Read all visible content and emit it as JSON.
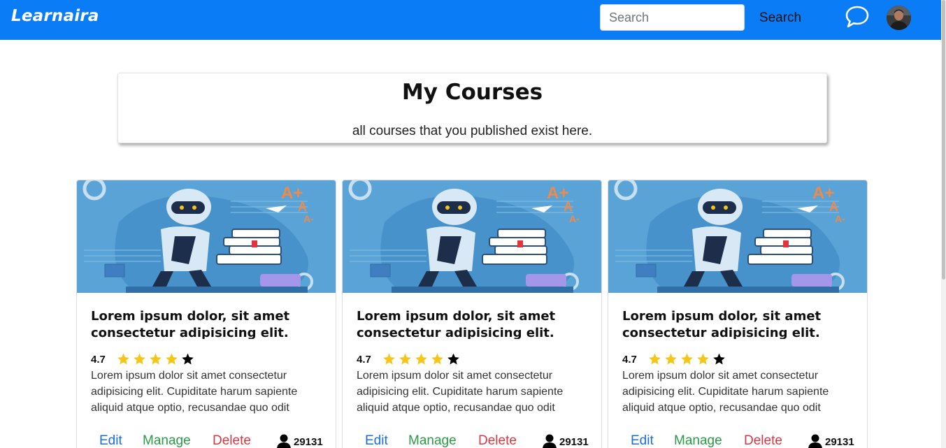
{
  "navbar": {
    "brand": "Learnaira",
    "search_placeholder": "Search",
    "search_button": "Search",
    "chat_icon": "chat-bubble-icon",
    "avatar": "user-avatar"
  },
  "header": {
    "title": "My Courses",
    "subtitle": "all courses that you published exist here."
  },
  "courses": [
    {
      "title": "Lorem ipsum dolor, sit amet consectetur adipisicing elit.",
      "rating": "4.7",
      "stars_filled": 4,
      "stars_total": 5,
      "description": "Lorem ipsum dolor sit amet consectetur adipisicing elit. Cupiditate harum sapiente aliquid atque optio, recusandae quo odit",
      "edit": "Edit",
      "manage": "Manage",
      "delete": "Delete",
      "students": "29131"
    },
    {
      "title": "Lorem ipsum dolor, sit amet consectetur adipisicing elit.",
      "rating": "4.7",
      "stars_filled": 4,
      "stars_total": 5,
      "description": "Lorem ipsum dolor sit amet consectetur adipisicing elit. Cupiditate harum sapiente aliquid atque optio, recusandae quo odit",
      "edit": "Edit",
      "manage": "Manage",
      "delete": "Delete",
      "students": "29131"
    },
    {
      "title": "Lorem ipsum dolor, sit amet consectetur adipisicing elit.",
      "rating": "4.7",
      "stars_filled": 4,
      "stars_total": 5,
      "description": "Lorem ipsum dolor sit amet consectetur adipisicing elit. Cupiditate harum sapiente aliquid atque optio, recusandae quo odit",
      "edit": "Edit",
      "manage": "Manage",
      "delete": "Delete",
      "students": "29131"
    }
  ],
  "colors": {
    "navbar": "#0a7cf6",
    "star_filled": "#f5c518",
    "star_empty": "#000000",
    "edit": "#1a6fd6",
    "manage": "#2a9a46",
    "delete": "#d63846"
  }
}
